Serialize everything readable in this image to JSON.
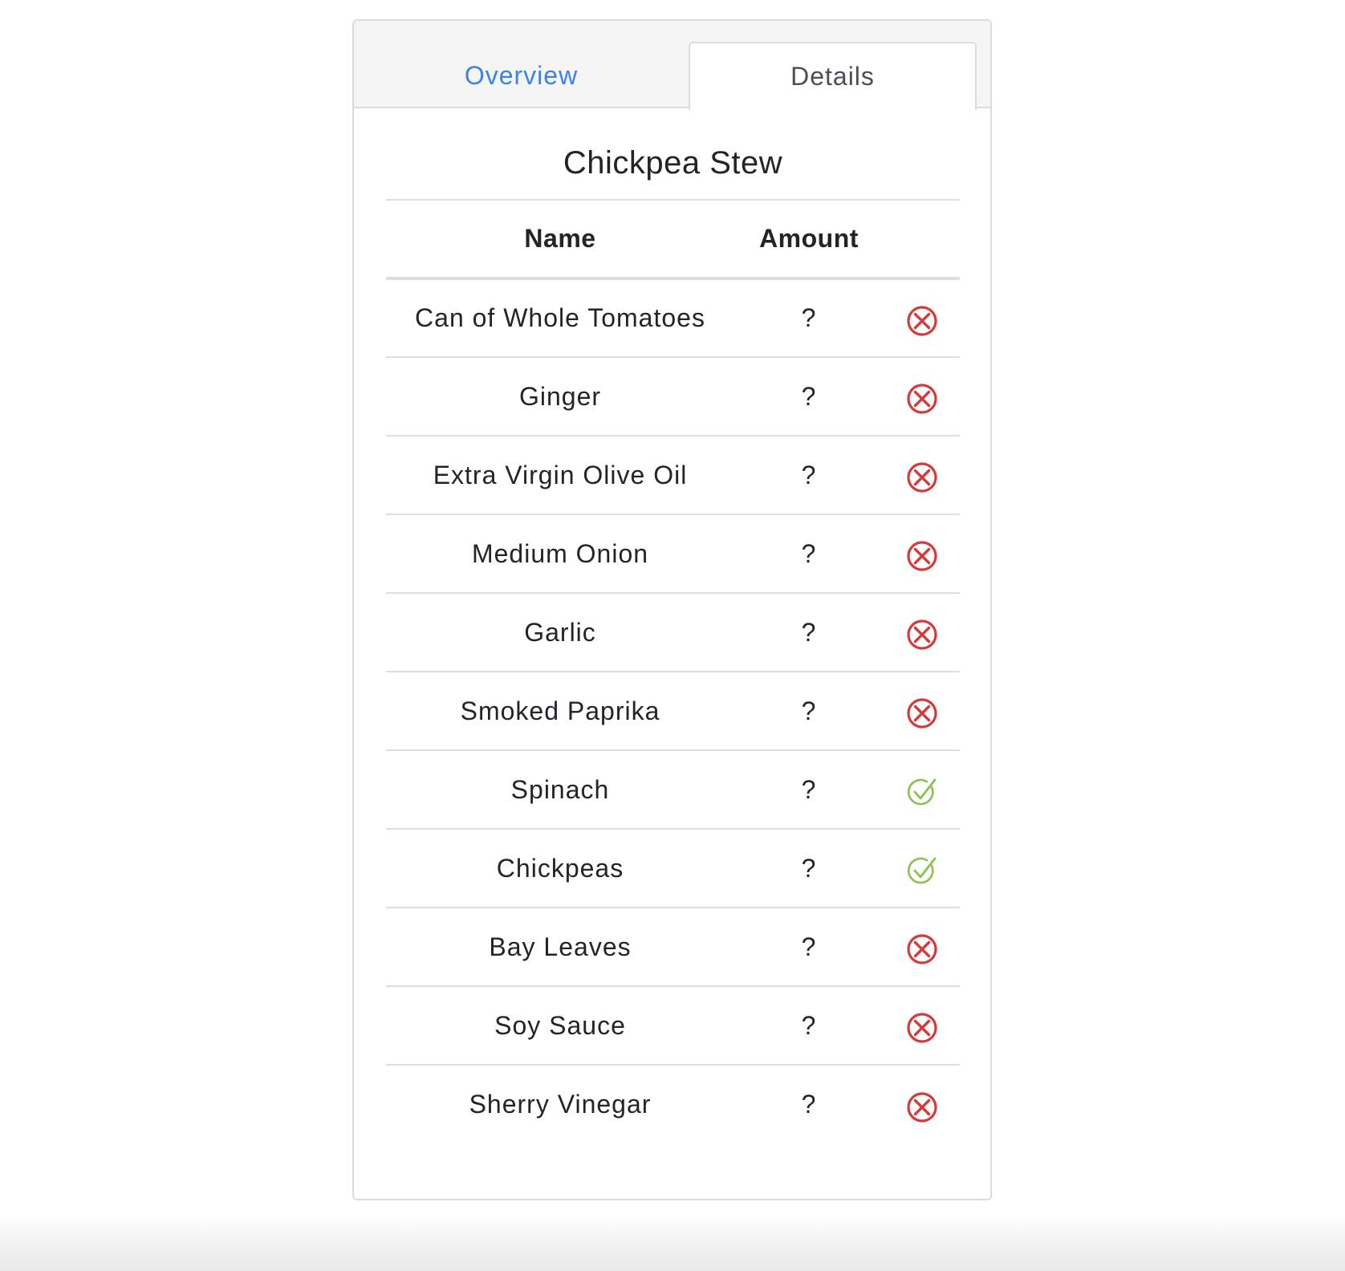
{
  "tabs": {
    "overview_label": "Overview",
    "details_label": "Details",
    "active": "Details"
  },
  "recipe": {
    "title": "Chickpea Stew"
  },
  "table": {
    "headers": {
      "name": "Name",
      "amount": "Amount"
    },
    "rows": [
      {
        "name": "Can of Whole Tomatoes",
        "amount": "?",
        "status": "missing"
      },
      {
        "name": "Ginger",
        "amount": "?",
        "status": "missing"
      },
      {
        "name": "Extra Virgin Olive Oil",
        "amount": "?",
        "status": "missing"
      },
      {
        "name": "Medium Onion",
        "amount": "?",
        "status": "missing"
      },
      {
        "name": "Garlic",
        "amount": "?",
        "status": "missing"
      },
      {
        "name": "Smoked Paprika",
        "amount": "?",
        "status": "missing"
      },
      {
        "name": "Spinach",
        "amount": "?",
        "status": "available"
      },
      {
        "name": "Chickpeas",
        "amount": "?",
        "status": "available"
      },
      {
        "name": "Bay Leaves",
        "amount": "?",
        "status": "missing"
      },
      {
        "name": "Soy Sauce",
        "amount": "?",
        "status": "missing"
      },
      {
        "name": "Sherry Vinegar",
        "amount": "?",
        "status": "missing"
      }
    ]
  },
  "icons": {
    "missing": "circle-x-icon",
    "available": "circle-check-icon"
  },
  "colors": {
    "link_blue": "#3d82e6",
    "missing_red": "#d43a3a",
    "available_green": "#8cc152",
    "border_gray": "#dcdcdc"
  }
}
